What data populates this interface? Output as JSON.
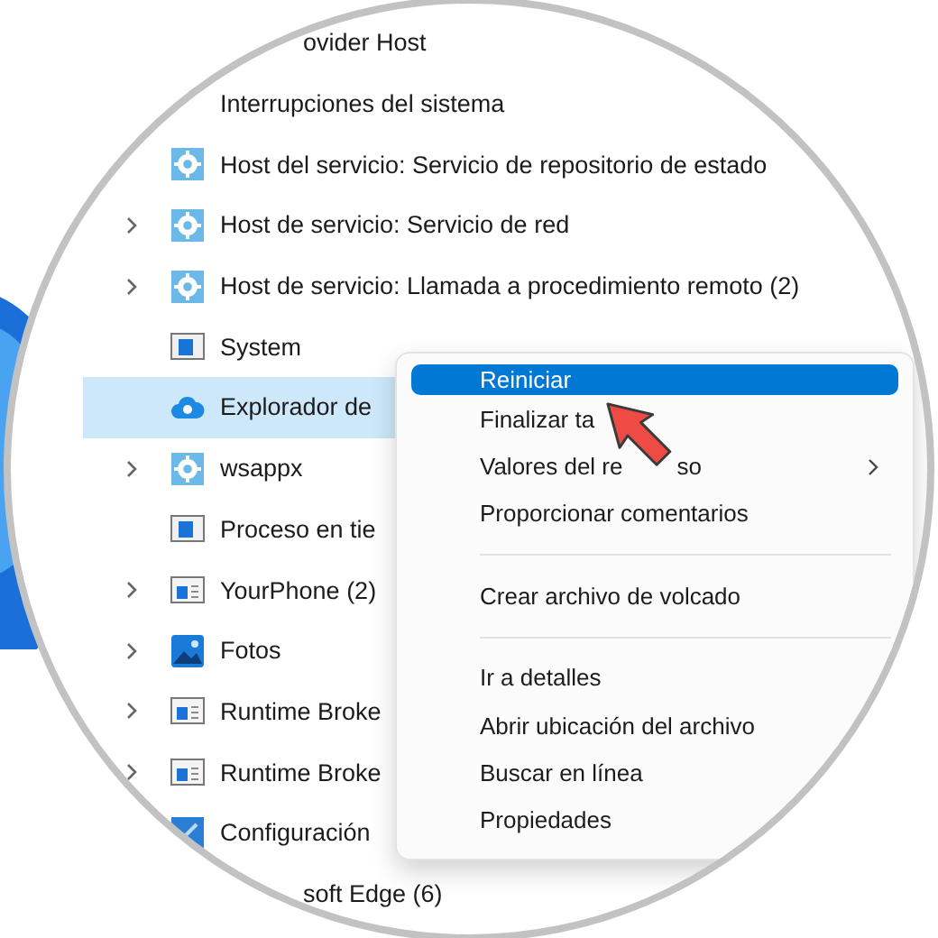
{
  "process_list": [
    {
      "text": "ovider Host",
      "kind": "cut",
      "selected": false
    },
    {
      "text": "Interrupciones del sistema",
      "kind": "plain",
      "selected": false
    },
    {
      "text": "Host del servicio: Servicio de repositorio de estado",
      "kind": "gear",
      "expandable": false,
      "selected": false
    },
    {
      "text": "Host de servicio: Servicio de red",
      "kind": "gear",
      "expandable": true,
      "selected": false
    },
    {
      "text": "Host de servicio: Llamada a procedimiento remoto (2)",
      "kind": "gear",
      "expandable": true,
      "selected": false
    },
    {
      "text": "System",
      "kind": "window",
      "expandable": false,
      "selected": false
    },
    {
      "text": "Explorador de",
      "kind": "explorer",
      "expandable": false,
      "selected": true
    },
    {
      "text": "wsappx",
      "kind": "gear",
      "expandable": true,
      "selected": false
    },
    {
      "text": "Proceso en tie",
      "kind": "window",
      "expandable": false,
      "selected": false
    },
    {
      "text": "YourPhone (2)",
      "kind": "app",
      "expandable": true,
      "selected": false
    },
    {
      "text": "Fotos",
      "kind": "photos",
      "expandable": true,
      "selected": false
    },
    {
      "text": "Runtime Broke",
      "kind": "app",
      "expandable": true,
      "selected": false
    },
    {
      "text": "Runtime Broke",
      "kind": "app",
      "expandable": true,
      "selected": false
    },
    {
      "text": "Configuración",
      "kind": "settings",
      "selected": false
    },
    {
      "text": "soft Edge (6)",
      "kind": "cut",
      "selected": false
    }
  ],
  "context_menu": [
    {
      "kind": "item",
      "text": "Reiniciar",
      "selected": true
    },
    {
      "kind": "item",
      "text": "Finalizar ta",
      "selected": false
    },
    {
      "kind": "submenu",
      "text": "Valores del re",
      "tail": "so",
      "selected": false
    },
    {
      "kind": "item",
      "text": "Proporcionar comentarios",
      "selected": false
    },
    {
      "kind": "separator"
    },
    {
      "kind": "item",
      "text": "Crear archivo de volcado",
      "selected": false
    },
    {
      "kind": "separator"
    },
    {
      "kind": "item",
      "text": "Ir a detalles",
      "selected": false
    },
    {
      "kind": "item",
      "text": "Abrir ubicación del archivo",
      "selected": false
    },
    {
      "kind": "item",
      "text": "Buscar en línea",
      "selected": false
    },
    {
      "kind": "item",
      "text": "Propiedades",
      "selected": false
    }
  ]
}
